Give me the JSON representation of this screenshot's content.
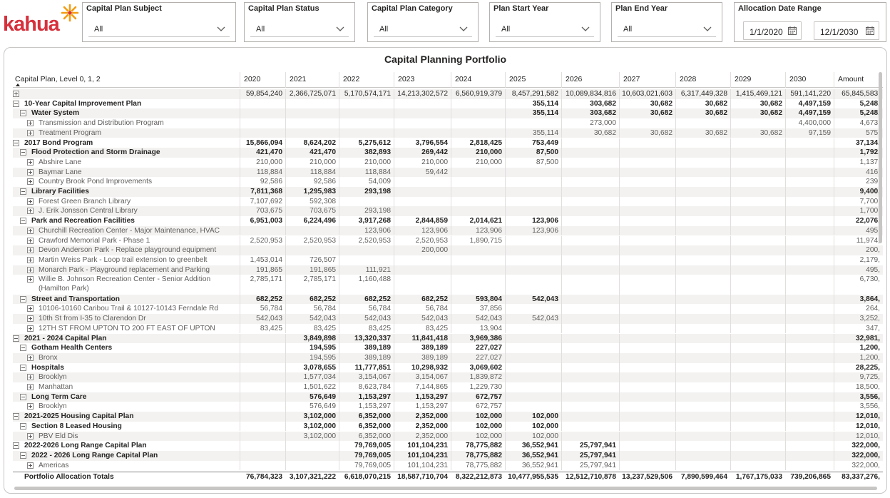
{
  "logo": {
    "text": "kahua"
  },
  "slicers": [
    {
      "title": "Capital Plan Subject",
      "value": "All"
    },
    {
      "title": "Capital Plan Status",
      "value": "All"
    },
    {
      "title": "Capital Plan Category",
      "value": "All"
    },
    {
      "title": "Plan Start Year",
      "value": "All"
    },
    {
      "title": "Plan End Year",
      "value": "All"
    }
  ],
  "date_range": {
    "title": "Allocation Date Range",
    "start": "1/1/2020",
    "end": "12/1/2030"
  },
  "matrix": {
    "title": "Capital Planning Portfolio",
    "row_header": "Capital Plan, Level 0, 1, 2",
    "columns": [
      "2020",
      "2021",
      "2022",
      "2023",
      "2024",
      "2025",
      "2026",
      "2027",
      "2028",
      "2029",
      "2030",
      "Amount"
    ],
    "rows": [
      {
        "level": 0,
        "toggle": "plus",
        "label": "",
        "v": [
          "59,854,240",
          "2,366,725,071",
          "5,170,574,171",
          "14,213,302,572",
          "6,560,919,379",
          "8,457,291,582",
          "10,089,834,816",
          "10,603,021,603",
          "6,317,449,328",
          "1,415,469,121",
          "591,141,220",
          "65,845,583,"
        ]
      },
      {
        "level": 1,
        "toggle": "minus",
        "label": "10-Year Capital Improvement Plan",
        "v": [
          "",
          "",
          "",
          "",
          "",
          "355,114",
          "303,682",
          "30,682",
          "30,682",
          "30,682",
          "4,497,159",
          "5,248,"
        ]
      },
      {
        "level": 2,
        "toggle": "minus",
        "label": "Water System",
        "v": [
          "",
          "",
          "",
          "",
          "",
          "355,114",
          "303,682",
          "30,682",
          "30,682",
          "30,682",
          "4,497,159",
          "5,248,"
        ]
      },
      {
        "level": 3,
        "toggle": "plus",
        "label": "Transmission and Distribution Program",
        "v": [
          "",
          "",
          "",
          "",
          "",
          "",
          "273,000",
          "",
          "",
          "",
          "4,400,000",
          "4,673,"
        ]
      },
      {
        "level": 3,
        "toggle": "plus",
        "label": "Treatment Program",
        "v": [
          "",
          "",
          "",
          "",
          "",
          "355,114",
          "30,682",
          "30,682",
          "30,682",
          "30,682",
          "97,159",
          "575,"
        ]
      },
      {
        "level": 1,
        "toggle": "minus",
        "label": "2017 Bond Program",
        "v": [
          "15,866,094",
          "8,624,202",
          "5,275,612",
          "3,796,554",
          "2,818,425",
          "753,449",
          "",
          "",
          "",
          "",
          "",
          "37,134,"
        ]
      },
      {
        "level": 2,
        "toggle": "minus",
        "label": "Flood Protection and Storm Drainage",
        "v": [
          "421,470",
          "421,470",
          "382,893",
          "269,442",
          "210,000",
          "87,500",
          "",
          "",
          "",
          "",
          "",
          "1,792,"
        ]
      },
      {
        "level": 3,
        "toggle": "plus",
        "label": "Abshire Lane",
        "v": [
          "210,000",
          "210,000",
          "210,000",
          "210,000",
          "210,000",
          "87,500",
          "",
          "",
          "",
          "",
          "",
          "1,137,"
        ]
      },
      {
        "level": 3,
        "toggle": "plus",
        "label": "Baymar Lane",
        "v": [
          "118,884",
          "118,884",
          "118,884",
          "59,442",
          "",
          "",
          "",
          "",
          "",
          "",
          "",
          "416,"
        ]
      },
      {
        "level": 3,
        "toggle": "plus",
        "label": "Country Brook Pond Improvements",
        "v": [
          "92,586",
          "92,586",
          "54,009",
          "",
          "",
          "",
          "",
          "",
          "",
          "",
          "",
          "239,"
        ]
      },
      {
        "level": 2,
        "toggle": "minus",
        "label": "Library Facilities",
        "v": [
          "7,811,368",
          "1,295,983",
          "293,198",
          "",
          "",
          "",
          "",
          "",
          "",
          "",
          "",
          "9,400,"
        ]
      },
      {
        "level": 3,
        "toggle": "plus",
        "label": "Forest Green Branch Library",
        "v": [
          "7,107,692",
          "592,308",
          "",
          "",
          "",
          "",
          "",
          "",
          "",
          "",
          "",
          "7,700,"
        ]
      },
      {
        "level": 3,
        "toggle": "plus",
        "label": "J. Erik Jonsson Central Library",
        "v": [
          "703,675",
          "703,675",
          "293,198",
          "",
          "",
          "",
          "",
          "",
          "",
          "",
          "",
          "1,700,"
        ]
      },
      {
        "level": 2,
        "toggle": "minus",
        "label": "Park and Recreation Facilities",
        "v": [
          "6,951,003",
          "6,224,496",
          "3,917,268",
          "2,844,859",
          "2,014,621",
          "123,906",
          "",
          "",
          "",
          "",
          "",
          "22,076,"
        ]
      },
      {
        "level": 3,
        "toggle": "plus",
        "label": "Churchill Recreation Center - Major Maintenance, HVAC",
        "v": [
          "",
          "",
          "123,906",
          "123,906",
          "123,906",
          "123,906",
          "",
          "",
          "",
          "",
          "",
          "495,"
        ]
      },
      {
        "level": 3,
        "toggle": "plus",
        "label": "Crawford Memorial Park - Phase 1",
        "v": [
          "2,520,953",
          "2,520,953",
          "2,520,953",
          "2,520,953",
          "1,890,715",
          "",
          "",
          "",
          "",
          "",
          "",
          "11,974,"
        ]
      },
      {
        "level": 3,
        "toggle": "plus",
        "label": "Devon Anderson Park - Replace playground equipment",
        "v": [
          "",
          "",
          "",
          "200,000",
          "",
          "",
          "",
          "",
          "",
          "",
          "",
          "200,"
        ]
      },
      {
        "level": 3,
        "toggle": "plus",
        "label": "Martin Weiss Park - Loop trail extension to greenbelt",
        "v": [
          "1,453,014",
          "726,507",
          "",
          "",
          "",
          "",
          "",
          "",
          "",
          "",
          "",
          "2,179,"
        ]
      },
      {
        "level": 3,
        "toggle": "plus",
        "label": "Monarch Park - Playground replacement and Parking",
        "v": [
          "191,865",
          "191,865",
          "111,921",
          "",
          "",
          "",
          "",
          "",
          "",
          "",
          "",
          "495,"
        ]
      },
      {
        "level": 3,
        "toggle": "plus",
        "label": "Willie B. Johnson Recreation Center - Senior Addition",
        "v": [
          "2,785,171",
          "2,785,171",
          "1,160,488",
          "",
          "",
          "",
          "",
          "",
          "",
          "",
          "",
          "6,730,"
        ],
        "wrap": "(Hamilton Park)"
      },
      {
        "level": 2,
        "toggle": "minus",
        "label": "Street and Transportation",
        "v": [
          "682,252",
          "682,252",
          "682,252",
          "682,252",
          "593,804",
          "542,043",
          "",
          "",
          "",
          "",
          "",
          "3,864,"
        ]
      },
      {
        "level": 3,
        "toggle": "plus",
        "label": "10106-10160 Caribou Trail & 10127-10143 Ferndale Rd",
        "v": [
          "56,784",
          "56,784",
          "56,784",
          "56,784",
          "37,856",
          "",
          "",
          "",
          "",
          "",
          "",
          "264,"
        ]
      },
      {
        "level": 3,
        "toggle": "plus",
        "label": "10th St from I-35 to Clarendon Dr",
        "v": [
          "542,043",
          "542,043",
          "542,043",
          "542,043",
          "542,043",
          "542,043",
          "",
          "",
          "",
          "",
          "",
          "3,252,"
        ]
      },
      {
        "level": 3,
        "toggle": "plus",
        "label": "12TH ST FROM UPTON TO 200 FT EAST OF UPTON",
        "v": [
          "83,425",
          "83,425",
          "83,425",
          "83,425",
          "13,904",
          "",
          "",
          "",
          "",
          "",
          "",
          "347,"
        ]
      },
      {
        "level": 1,
        "toggle": "minus",
        "label": "2021 - 2024 Capital Plan",
        "v": [
          "",
          "3,849,898",
          "13,320,337",
          "11,841,418",
          "3,969,386",
          "",
          "",
          "",
          "",
          "",
          "",
          "32,981,"
        ]
      },
      {
        "level": 2,
        "toggle": "minus",
        "label": "Gotham Health Centers",
        "v": [
          "",
          "194,595",
          "389,189",
          "389,189",
          "227,027",
          "",
          "",
          "",
          "",
          "",
          "",
          "1,200,"
        ]
      },
      {
        "level": 3,
        "toggle": "plus",
        "label": "Bronx",
        "v": [
          "",
          "194,595",
          "389,189",
          "389,189",
          "227,027",
          "",
          "",
          "",
          "",
          "",
          "",
          "1,200,"
        ]
      },
      {
        "level": 2,
        "toggle": "minus",
        "label": "Hospitals",
        "v": [
          "",
          "3,078,655",
          "11,777,851",
          "10,298,932",
          "3,069,602",
          "",
          "",
          "",
          "",
          "",
          "",
          "28,225,"
        ]
      },
      {
        "level": 3,
        "toggle": "plus",
        "label": "Brooklyn",
        "v": [
          "",
          "1,577,034",
          "3,154,067",
          "3,154,067",
          "1,839,872",
          "",
          "",
          "",
          "",
          "",
          "",
          "9,725,"
        ]
      },
      {
        "level": 3,
        "toggle": "plus",
        "label": "Manhattan",
        "v": [
          "",
          "1,501,622",
          "8,623,784",
          "7,144,865",
          "1,229,730",
          "",
          "",
          "",
          "",
          "",
          "",
          "18,500,"
        ]
      },
      {
        "level": 2,
        "toggle": "minus",
        "label": "Long Term Care",
        "v": [
          "",
          "576,649",
          "1,153,297",
          "1,153,297",
          "672,757",
          "",
          "",
          "",
          "",
          "",
          "",
          "3,556,"
        ]
      },
      {
        "level": 3,
        "toggle": "plus",
        "label": "Brooklyn",
        "v": [
          "",
          "576,649",
          "1,153,297",
          "1,153,297",
          "672,757",
          "",
          "",
          "",
          "",
          "",
          "",
          "3,556,"
        ]
      },
      {
        "level": 1,
        "toggle": "minus",
        "label": "2021-2025 Housing Capital Plan",
        "v": [
          "",
          "3,102,000",
          "6,352,000",
          "2,352,000",
          "102,000",
          "102,000",
          "",
          "",
          "",
          "",
          "",
          "12,010,"
        ]
      },
      {
        "level": 2,
        "toggle": "minus",
        "label": "Section 8 Leased Housing",
        "v": [
          "",
          "3,102,000",
          "6,352,000",
          "2,352,000",
          "102,000",
          "102,000",
          "",
          "",
          "",
          "",
          "",
          "12,010,"
        ]
      },
      {
        "level": 3,
        "toggle": "plus",
        "label": "PBV Eld Dis",
        "v": [
          "",
          "3,102,000",
          "6,352,000",
          "2,352,000",
          "102,000",
          "102,000",
          "",
          "",
          "",
          "",
          "",
          "12,010,"
        ]
      },
      {
        "level": 1,
        "toggle": "minus",
        "label": "2022-2026 Long Range Capital Plan",
        "v": [
          "",
          "",
          "79,769,005",
          "101,104,231",
          "78,775,882",
          "36,552,941",
          "25,797,941",
          "",
          "",
          "",
          "",
          "322,000,"
        ]
      },
      {
        "level": 2,
        "toggle": "minus",
        "label": "2022 - 2026 Long Range Capital Plan",
        "v": [
          "",
          "",
          "79,769,005",
          "101,104,231",
          "78,775,882",
          "36,552,941",
          "25,797,941",
          "",
          "",
          "",
          "",
          "322,000,"
        ]
      },
      {
        "level": 3,
        "toggle": "plus",
        "label": "Americas",
        "v": [
          "",
          "",
          "79,769,005",
          "101,104,231",
          "78,775,882",
          "36,552,941",
          "25,797,941",
          "",
          "",
          "",
          "",
          "322,000,"
        ]
      }
    ],
    "totals": {
      "label": "Portfolio Allocation Totals",
      "v": [
        "76,784,323",
        "3,107,321,222",
        "6,618,070,215",
        "18,587,710,704",
        "8,322,212,873",
        "10,477,955,535",
        "12,512,710,878",
        "13,237,529,506",
        "7,890,599,464",
        "1,767,175,033",
        "739,206,865",
        "83,337,276,"
      ]
    }
  }
}
